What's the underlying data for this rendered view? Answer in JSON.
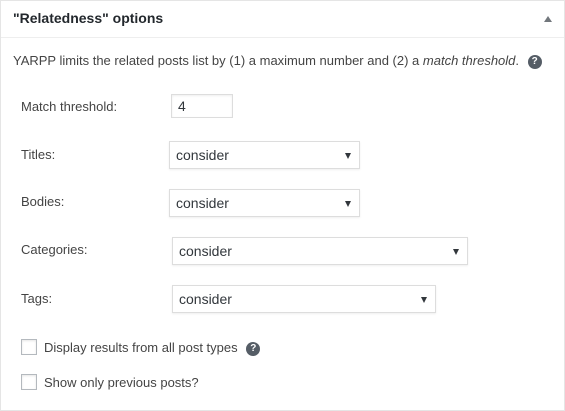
{
  "panel": {
    "title": "\"Relatedness\" options",
    "toggle_icon": "triangle-up-icon"
  },
  "intro": {
    "text_before": "YARPP limits the related posts list by (1) a maximum number and (2) a ",
    "emphasis": "match threshold",
    "text_after": ".",
    "help_glyph": "?"
  },
  "fields": {
    "match_threshold": {
      "label": "Match threshold:",
      "value": "4"
    },
    "titles": {
      "label": "Titles:",
      "selected": "consider"
    },
    "bodies": {
      "label": "Bodies:",
      "selected": "consider"
    },
    "categories": {
      "label": "Categories:",
      "selected": "consider"
    },
    "tags": {
      "label": "Tags:",
      "selected": "consider"
    }
  },
  "checkboxes": {
    "all_post_types": {
      "label": "Display results from all post types",
      "checked": false,
      "help_glyph": "?"
    },
    "previous_posts": {
      "label": "Show only previous posts?",
      "checked": false
    }
  },
  "colors": {
    "text": "#444444",
    "heading": "#23282d",
    "border": "#dddddd",
    "help_icon_bg": "#555d66"
  }
}
